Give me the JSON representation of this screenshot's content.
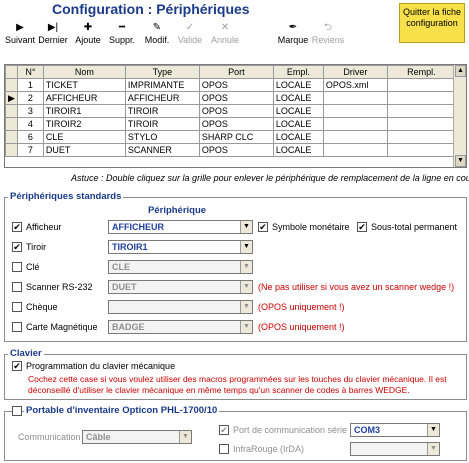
{
  "title": "Configuration : Périphériques",
  "quit_button": "Quitter la fiche configuration",
  "toolbar": [
    {
      "label": "Suivant",
      "icon": "▶"
    },
    {
      "label": "Dernier",
      "icon": "▶|"
    },
    {
      "label": "Ajoute",
      "icon": "✚"
    },
    {
      "label": "Suppr.",
      "icon": "━"
    },
    {
      "label": "Modif.",
      "icon": "✎"
    },
    {
      "label": "Valide",
      "icon": "✓"
    },
    {
      "label": "Annule",
      "icon": "✕"
    },
    {
      "label": "Marque",
      "icon": "✒"
    },
    {
      "label": "Reviens",
      "icon": "⮌"
    }
  ],
  "grid": {
    "headers": [
      "N°",
      "Nom",
      "Type",
      "Port",
      "Empl.",
      "Driver",
      "Rempl."
    ],
    "rows": [
      [
        "1",
        "TICKET",
        "IMPRIMANTE",
        "OPOS",
        "LOCALE",
        "OPOS.xml",
        ""
      ],
      [
        "2",
        "AFFICHEUR",
        "AFFICHEUR",
        "OPOS",
        "LOCALE",
        "",
        ""
      ],
      [
        "3",
        "TIROIR1",
        "TIROIR",
        "OPOS",
        "LOCALE",
        "",
        ""
      ],
      [
        "4",
        "TIROIR2",
        "TIROIR",
        "OPOS",
        "LOCALE",
        "",
        ""
      ],
      [
        "6",
        "CLE",
        "STYLO",
        "SHARP CLC",
        "LOCALE",
        "",
        ""
      ],
      [
        "7",
        "DUET",
        "SCANNER",
        "OPOS",
        "LOCALE",
        "",
        ""
      ]
    ],
    "current_row_marker": "▶"
  },
  "astuce": "Astuce : Double cliquez sur la grille pour enlever le périphérique de remplacement de la ligne en cours.",
  "standards": {
    "title": "Périphériques standards",
    "col_header": "Périphérique",
    "rows": [
      {
        "label": "Afficheur",
        "checked": "✔",
        "value": "AFFICHEUR",
        "note": ""
      },
      {
        "label": "Tiroir",
        "checked": "✔",
        "value": "TIROIR1",
        "note": ""
      },
      {
        "label": "Clé",
        "checked": "",
        "value": "CLE",
        "note": ""
      },
      {
        "label": "Scanner RS-232",
        "checked": "",
        "value": "DUET",
        "note": "(Ne pas utiliser si vous avez un scanner wedge !)"
      },
      {
        "label": "Chèque",
        "checked": "",
        "value": "",
        "note": "(OPOS uniquement !)"
      },
      {
        "label": "Carte Magnétique",
        "checked": "",
        "value": "BADGE",
        "note": "(OPOS uniquement !)"
      }
    ],
    "symbole": {
      "label": "Symbole monétaire",
      "checked": "✔"
    },
    "sous_total": {
      "label": "Sous-total permanent",
      "checked": "✔"
    }
  },
  "clavier": {
    "title": "Clavier",
    "check_label": "Programmation du clavier mécanique",
    "checked": "✔",
    "note": "Cochez cette case si vous voulez utiliser des macros programmées sur les touches du clavier mécanique. Il est déconseillé d'utiliser le clavier mécanique en même temps qu'un scanner de codes à barres WEDGE."
  },
  "opticon": {
    "title": "Portable d'inventaire Opticon PHL-1700/10",
    "communication_label": "Communication",
    "communication_value": "Câble",
    "port_label": "Port de communication série",
    "port_checked": "✔",
    "port_value": "COM3",
    "ir_label": "InfraRouge (IrDA)",
    "ir_value": ""
  },
  "colors": {
    "title": "#1a3a8a",
    "warning": "#cc0000",
    "quit_bg": "#f7e04a"
  }
}
